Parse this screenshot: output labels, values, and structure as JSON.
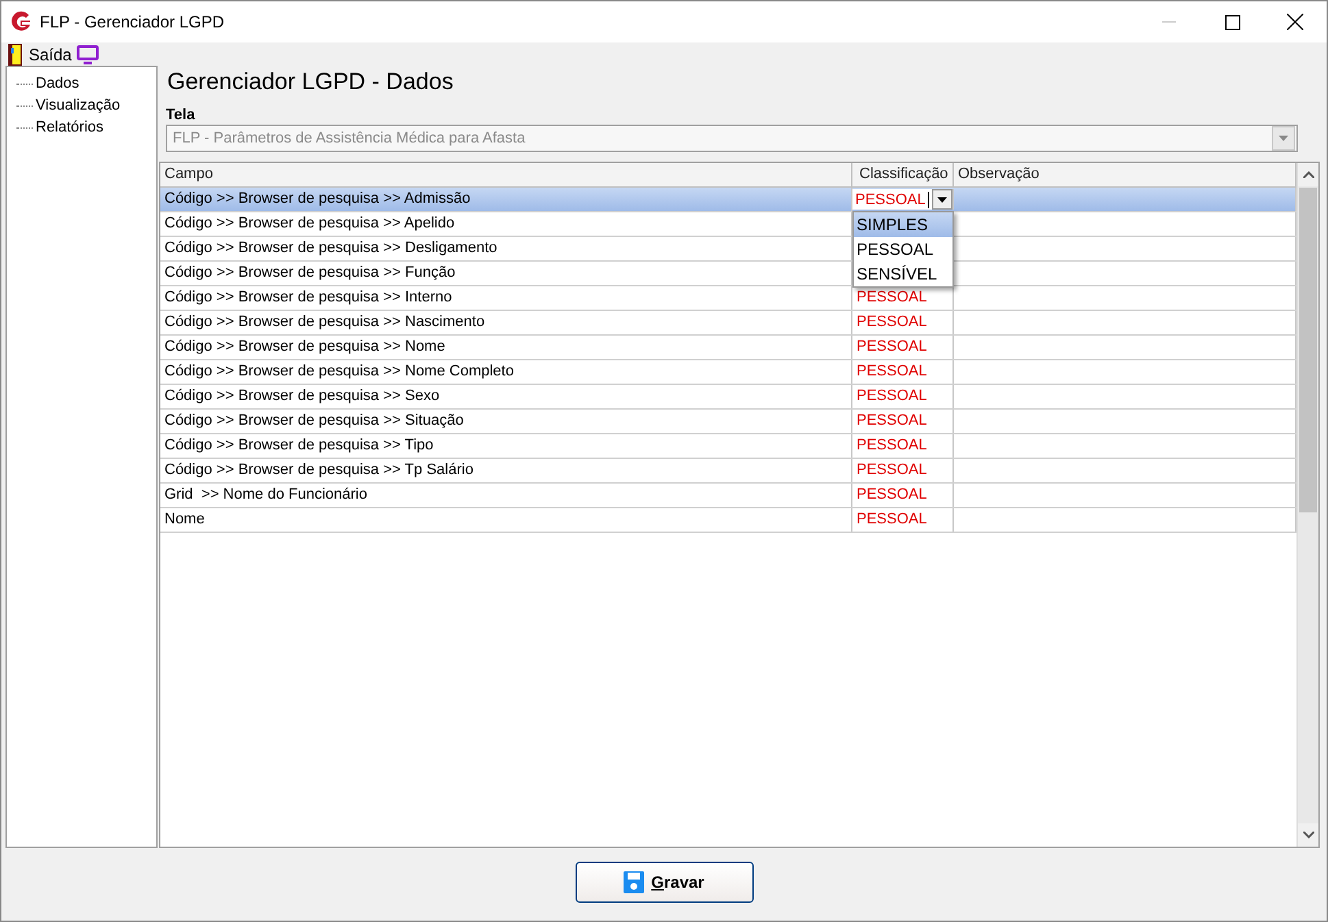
{
  "window": {
    "title": "FLP - Gerenciador LGPD"
  },
  "toolbar": {
    "exit_label": "Saída"
  },
  "tree": [
    {
      "label": "Dados"
    },
    {
      "label": "Visualização"
    },
    {
      "label": "Relatórios"
    }
  ],
  "heading": "Gerenciador LGPD - Dados",
  "screen_field": {
    "label": "Tela",
    "value": "FLP - Parâmetros de Assistência Médica para Afasta",
    "disabled": true
  },
  "table": {
    "columns": [
      "Campo",
      "Classificação",
      "Observação"
    ],
    "rows": [
      {
        "campo": "Código >> Browser de pesquisa >> Admissão",
        "classificacao": "PESSOAL",
        "selected": true,
        "editing": true
      },
      {
        "campo": "Código >> Browser de pesquisa >> Apelido",
        "selected": false,
        "editing": false
      },
      {
        "campo": "Código >> Browser de pesquisa >> Desligamento",
        "selected": false,
        "editing": false
      },
      {
        "campo": "Código >> Browser de pesquisa >> Função",
        "selected": false,
        "editing": false
      },
      {
        "campo": "Código >> Browser de pesquisa >> Interno",
        "classificacao": "PESSOAL",
        "selected": false,
        "editing": false
      },
      {
        "campo": "Código >> Browser de pesquisa >> Nascimento",
        "classificacao": "PESSOAL",
        "selected": false,
        "editing": false
      },
      {
        "campo": "Código >> Browser de pesquisa >> Nome",
        "classificacao": "PESSOAL",
        "selected": false,
        "editing": false
      },
      {
        "campo": "Código >> Browser de pesquisa >> Nome Completo",
        "classificacao": "PESSOAL",
        "selected": false,
        "editing": false
      },
      {
        "campo": "Código >> Browser de pesquisa >> Sexo",
        "classificacao": "PESSOAL",
        "selected": false,
        "editing": false
      },
      {
        "campo": "Código >> Browser de pesquisa >> Situação",
        "classificacao": "PESSOAL",
        "selected": false,
        "editing": false
      },
      {
        "campo": "Código >> Browser de pesquisa >> Tipo",
        "classificacao": "PESSOAL",
        "selected": false,
        "editing": false
      },
      {
        "campo": "Código >> Browser de pesquisa >> Tp Salário",
        "classificacao": "PESSOAL",
        "selected": false,
        "editing": false
      },
      {
        "campo": "Grid  >> Nome do Funcionário",
        "classificacao": "PESSOAL",
        "selected": false,
        "editing": false
      },
      {
        "campo": "Nome",
        "classificacao": "PESSOAL",
        "selected": false,
        "editing": false
      }
    ],
    "dropdown": [
      {
        "label": "SIMPLES",
        "selected": true
      },
      {
        "label": "PESSOAL",
        "selected": false
      },
      {
        "label": "SENSÍVEL",
        "selected": false
      }
    ]
  },
  "save_button": {
    "label": "Gravar"
  }
}
